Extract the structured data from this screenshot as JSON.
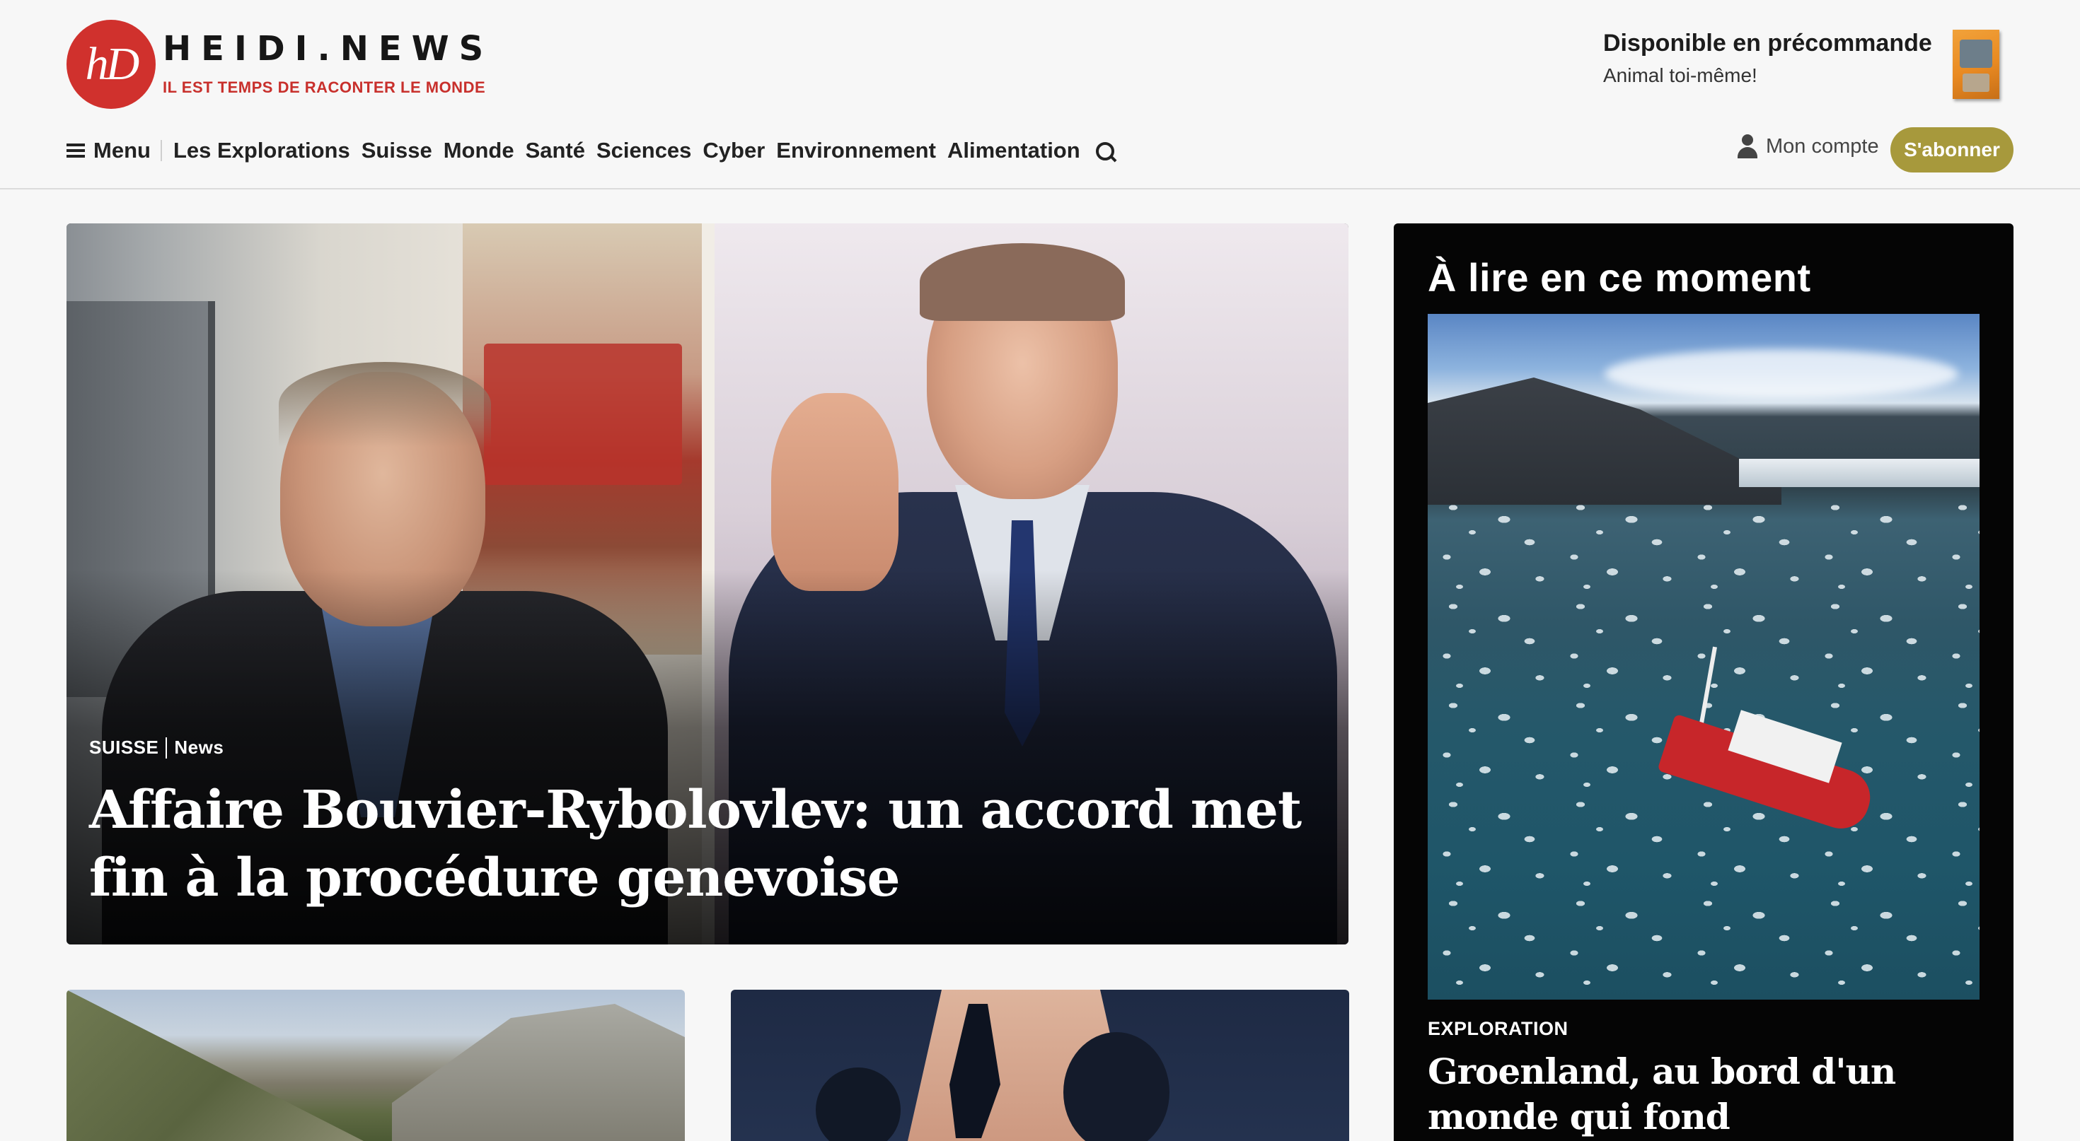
{
  "brand": {
    "logo_mark": "hD",
    "name": "HEIDI.NEWS",
    "tagline": "IL EST TEMPS DE RACONTER LE MONDE",
    "accent_color": "#d0312d"
  },
  "promo": {
    "title": "Disponible en précommande",
    "subtitle": "Animal toi-même!"
  },
  "nav": {
    "menu_label": "Menu",
    "items": [
      "Les Explorations",
      "Suisse",
      "Monde",
      "Santé",
      "Sciences",
      "Cyber",
      "Environnement",
      "Alimentation"
    ],
    "search_icon": "search-icon"
  },
  "account": {
    "label": "Mon compte",
    "subscribe_label": "S'abonner",
    "subscribe_color": "#a7993c"
  },
  "hero": {
    "section": "SUISSE",
    "type": "News",
    "title": "Affaire Bouvier-Rybolovlev: un accord met fin à la procédure genevoise"
  },
  "sidebar": {
    "heading": "À lire en ce moment",
    "kicker": "EXPLORATION",
    "title": "Groenland, au bord d'un monde qui fond"
  }
}
